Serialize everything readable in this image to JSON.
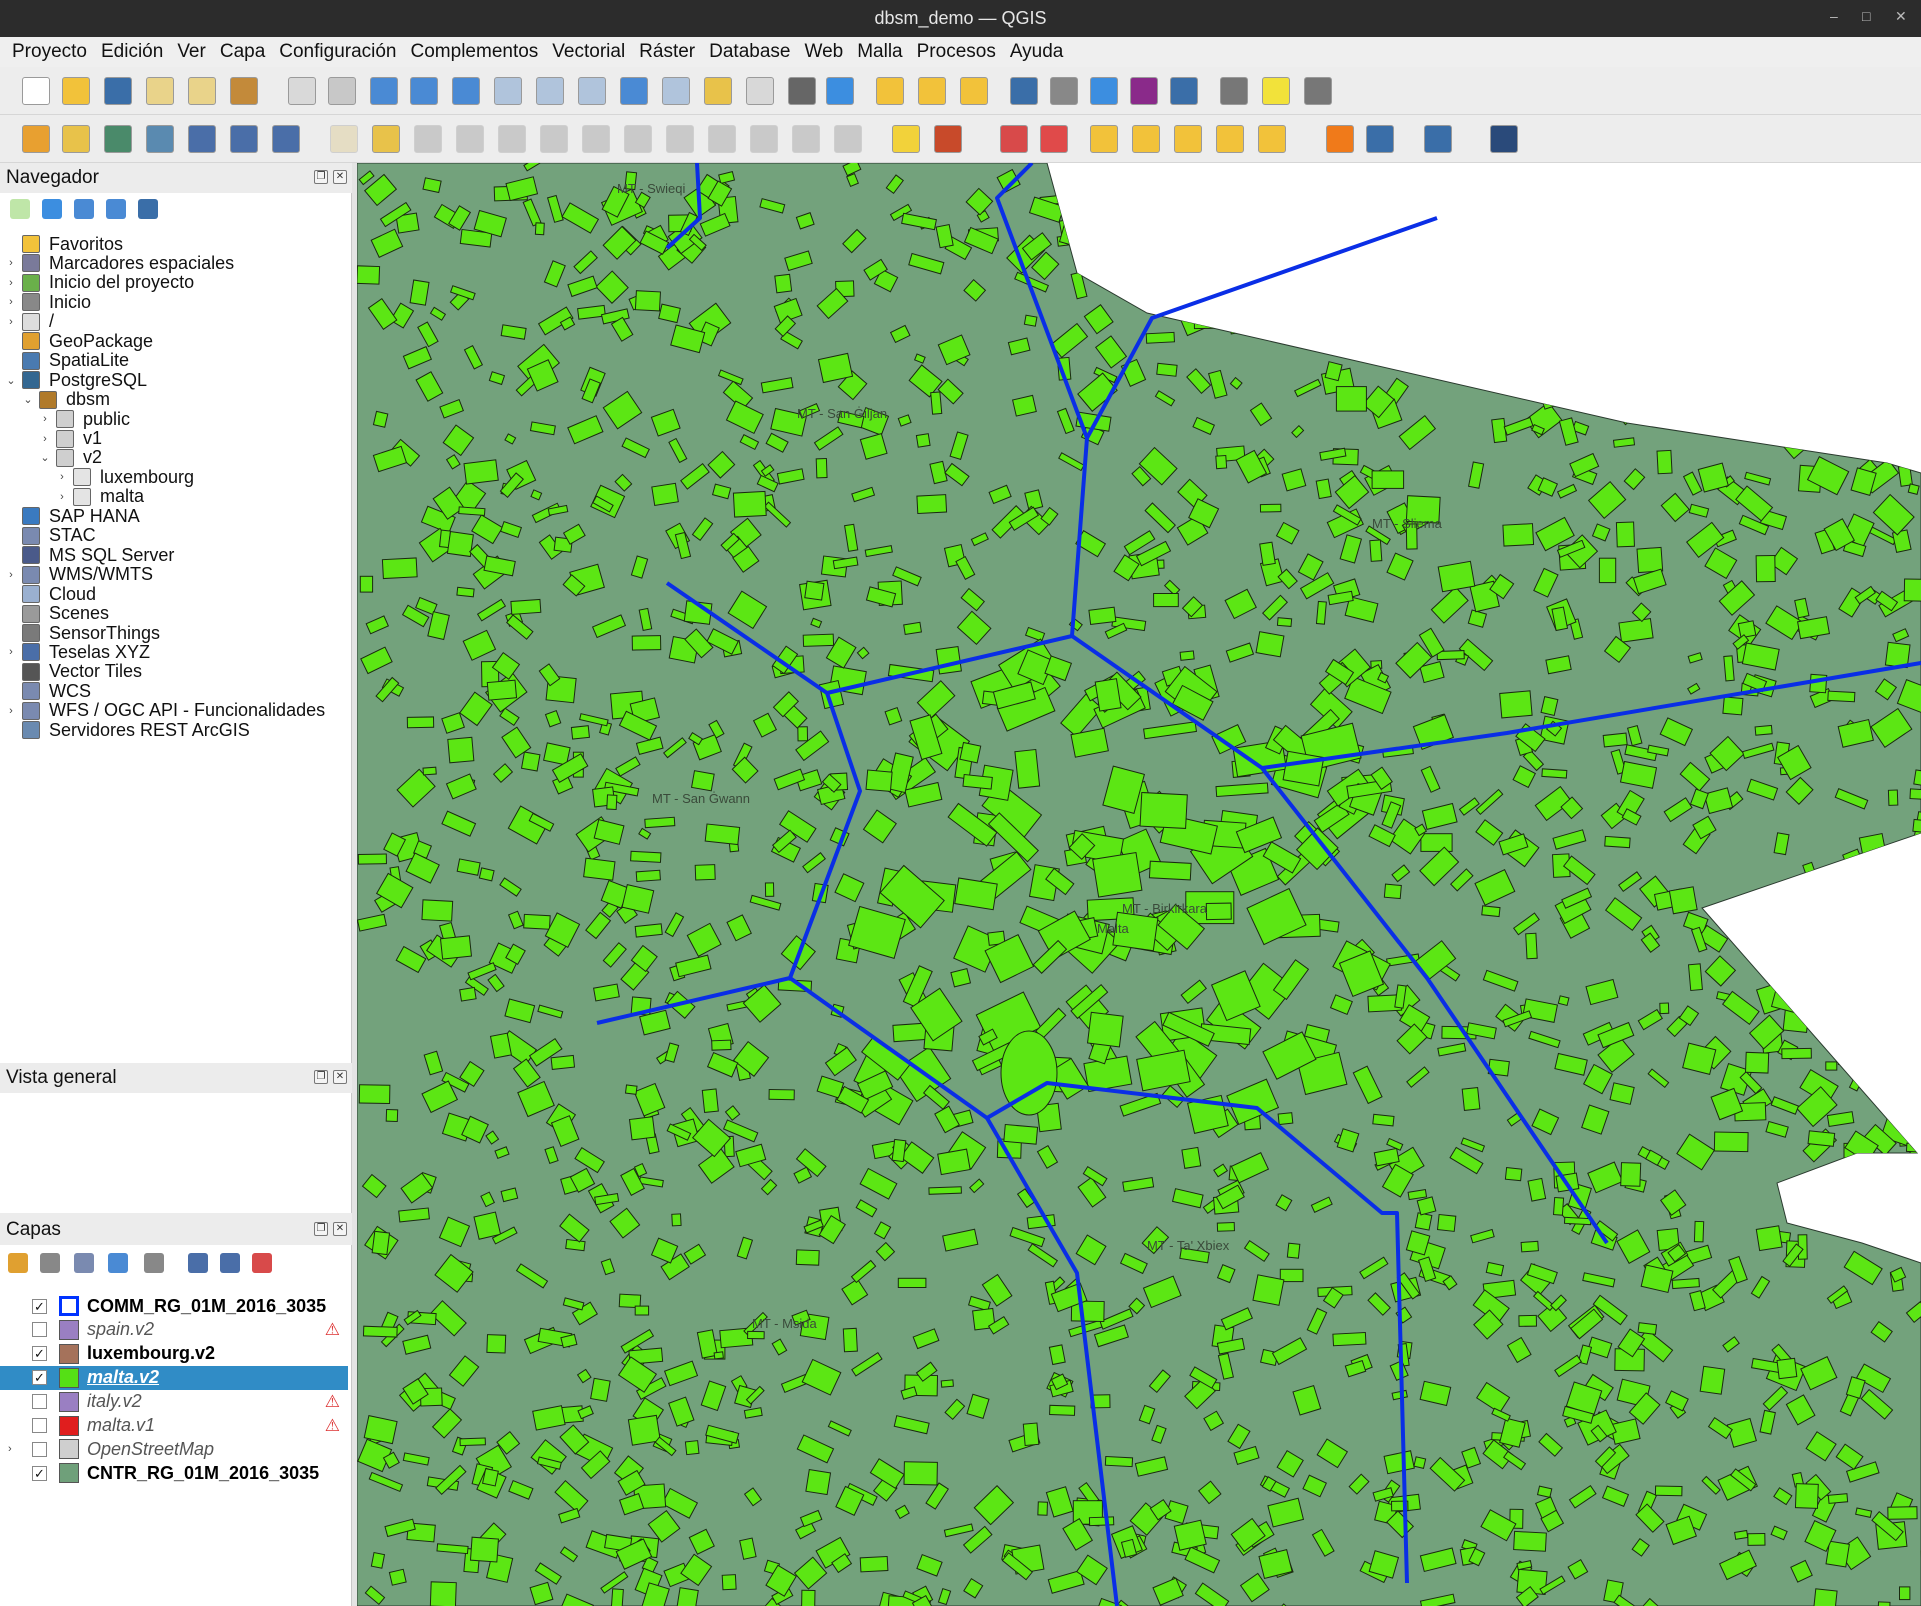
{
  "window": {
    "title": "dbsm_demo — QGIS",
    "controls": [
      "–",
      "□",
      "✕"
    ]
  },
  "menu": [
    "Proyecto",
    "Edición",
    "Ver",
    "Capa",
    "Configuración",
    "Complementos",
    "Vectorial",
    "Ráster",
    "Database",
    "Web",
    "Malla",
    "Procesos",
    "Ayuda"
  ],
  "browser": {
    "title": "Navegador",
    "items": [
      {
        "label": "Favoritos",
        "icon": "star-icon",
        "arrow": ""
      },
      {
        "label": "Marcadores espaciales",
        "icon": "bookmark-icon",
        "arrow": "›"
      },
      {
        "label": "Inicio del proyecto",
        "icon": "project-home-icon",
        "arrow": "›"
      },
      {
        "label": "Inicio",
        "icon": "home-icon",
        "arrow": "›"
      },
      {
        "label": "/",
        "icon": "folder-icon",
        "arrow": "›"
      },
      {
        "label": "GeoPackage",
        "icon": "geopackage-icon",
        "arrow": ""
      },
      {
        "label": "SpatiaLite",
        "icon": "spatialite-icon",
        "arrow": ""
      },
      {
        "label": "PostgreSQL",
        "icon": "postgresql-icon",
        "arrow": "⌄"
      },
      {
        "label": "dbsm",
        "icon": "connection-icon",
        "arrow": "⌄"
      },
      {
        "label": "public",
        "icon": "schema-icon",
        "arrow": "›"
      },
      {
        "label": "v1",
        "icon": "schema-icon",
        "arrow": "›"
      },
      {
        "label": "v2",
        "icon": "schema-icon",
        "arrow": "⌄"
      },
      {
        "label": "luxembourg",
        "icon": "table-icon",
        "arrow": "›"
      },
      {
        "label": "malta",
        "icon": "table-icon",
        "arrow": "›"
      },
      {
        "label": "SAP HANA",
        "icon": "sap-hana-icon",
        "arrow": ""
      },
      {
        "label": "STAC",
        "icon": "stac-icon",
        "arrow": ""
      },
      {
        "label": "MS SQL Server",
        "icon": "mssql-icon",
        "arrow": ""
      },
      {
        "label": "WMS/WMTS",
        "icon": "globe-icon",
        "arrow": "›"
      },
      {
        "label": "Cloud",
        "icon": "cloud-icon",
        "arrow": ""
      },
      {
        "label": "Scenes",
        "icon": "scenes-icon",
        "arrow": ""
      },
      {
        "label": "SensorThings",
        "icon": "sensor-icon",
        "arrow": ""
      },
      {
        "label": "Teselas XYZ",
        "icon": "grid-icon",
        "arrow": "›"
      },
      {
        "label": "Vector Tiles",
        "icon": "vector-tiles-icon",
        "arrow": ""
      },
      {
        "label": "WCS",
        "icon": "globe-icon",
        "arrow": ""
      },
      {
        "label": "WFS / OGC API - Funcionalidades",
        "icon": "globe-icon",
        "arrow": "›"
      },
      {
        "label": "Servidores REST ArcGIS",
        "icon": "arcgis-icon",
        "arrow": ""
      }
    ]
  },
  "overview": {
    "title": "Vista general"
  },
  "layers": {
    "title": "Capas",
    "items": [
      {
        "label": "COMM_RG_01M_2016_3035",
        "checked": "✓",
        "color": "#0033ff",
        "fill": "#ffffff",
        "bold": true,
        "italic": false,
        "warn": "",
        "selected": false
      },
      {
        "label": "spain.v2",
        "checked": "",
        "color": "#555555",
        "fill": "#9a7fc2",
        "bold": false,
        "italic": true,
        "warn": "⚠",
        "selected": false
      },
      {
        "label": "luxembourg.v2",
        "checked": "✓",
        "color": "#555555",
        "fill": "#a5725b",
        "bold": true,
        "italic": false,
        "warn": "",
        "selected": false
      },
      {
        "label": "malta.v2",
        "checked": "✓",
        "color": "#555555",
        "fill": "#55e015",
        "bold": true,
        "italic": true,
        "warn": "",
        "selected": true
      },
      {
        "label": "italy.v2",
        "checked": "",
        "color": "#555555",
        "fill": "#9a7fc2",
        "bold": false,
        "italic": true,
        "warn": "⚠",
        "selected": false
      },
      {
        "label": "malta.v1",
        "checked": "",
        "color": "#555555",
        "fill": "#e01e1e",
        "bold": false,
        "italic": true,
        "warn": "⚠",
        "selected": false
      },
      {
        "label": "OpenStreetMap",
        "checked": "",
        "color": "#555555",
        "fill": "#cfcfcf",
        "bold": false,
        "italic": true,
        "warn": "",
        "selected": false
      },
      {
        "label": "CNTR_RG_01M_2016_3035",
        "checked": "✓",
        "color": "#555555",
        "fill": "#6fa07a",
        "bold": true,
        "italic": false,
        "warn": "",
        "selected": false
      }
    ]
  },
  "map": {
    "land_color": "#73a27c",
    "building_color": "#5ce614",
    "boundary_color": "#0a2ee6",
    "labels": [
      "MT - Swieqi",
      "MT - San Ġiljan",
      "MT - Sliema",
      "MT - San Ġwann",
      "MT - Birkirkara",
      "Malta",
      "MT - Ta' Xbiex",
      "MT - Msida"
    ]
  }
}
